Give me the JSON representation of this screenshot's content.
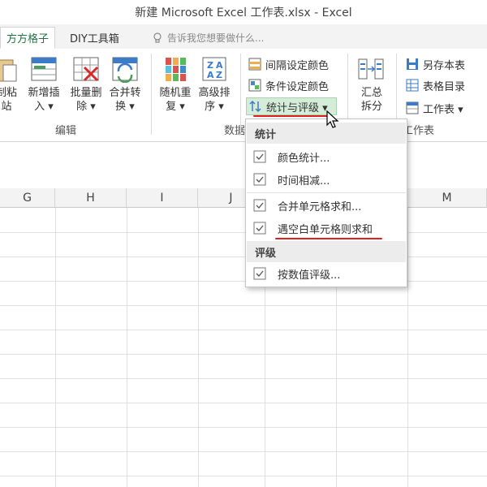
{
  "window": {
    "title": "新建 Microsoft Excel 工作表.xlsx - Excel"
  },
  "tabs": {
    "active": "方方格子",
    "diy": "DIY工具箱",
    "tell_me": "告诉我您想要做什么..."
  },
  "ribbon": {
    "paste": {
      "line1": "制粘",
      "line2": "站"
    },
    "insert_new": {
      "line1": "新增插",
      "line2": "入 ▾"
    },
    "batch_delete": {
      "line1": "批量删",
      "line2": "除 ▾"
    },
    "merge_convert": {
      "line1": "合并转",
      "line2": "换 ▾"
    },
    "group_edit_label": "编辑",
    "random_repeat": {
      "line1": "随机重",
      "line2": "复 ▾"
    },
    "advanced_sort": {
      "line1": "高级排",
      "line2": "序 ▾"
    },
    "group_data_label": "数据",
    "interval_color": "间隔设定颜色",
    "condition_color": "条件设定颜色",
    "stats_rating": "统计与评级 ▾",
    "summary_split": {
      "line1": "汇总",
      "line2": "拆分"
    },
    "save_sheet": "另存本表",
    "sheet_dir": "表格目录",
    "worksheet": "工作表 ▾",
    "group_sheet_label": "工作表"
  },
  "columns": [
    "G",
    "H",
    "I",
    "J",
    "M"
  ],
  "menu": {
    "section_stats": "统计",
    "color_stats": "颜色统计...",
    "time_add_sub": "时间相减...",
    "merge_sum": "合并单元格求和...",
    "blank_sum": "遇空白单元格则求和",
    "section_rating": "评级",
    "value_rating": "按数值评级..."
  },
  "colors": {
    "accent": "#217346",
    "highlight": "#d5ecd8",
    "annotation": "#e0201f"
  }
}
